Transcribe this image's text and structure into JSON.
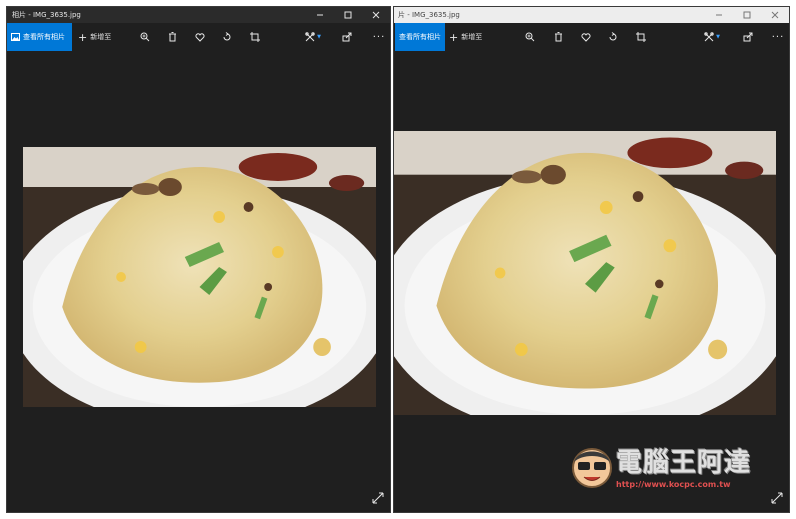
{
  "left_window": {
    "title": "相片 - IMG_3635.jpg",
    "all_photos_label": "查看所有相片",
    "add_label": "新增至",
    "more_label": "···"
  },
  "right_window": {
    "title": "片 - IMG_3635.jpg",
    "all_photos_label": "查看所有相片",
    "add_label": "新增至",
    "more_label": "···"
  },
  "watermark": {
    "name": "電腦王阿達",
    "url": "http://www.kocpc.com.tw"
  },
  "icons": {
    "minimize": "minimize-icon",
    "maximize": "maximize-icon",
    "close": "close-icon",
    "photos": "photos-icon",
    "add": "plus-icon",
    "zoom": "zoom-in-icon",
    "delete": "trash-icon",
    "favorite": "heart-icon",
    "rotate": "rotate-icon",
    "crop": "crop-icon",
    "edit": "edit-icon",
    "share": "share-icon",
    "expand": "expand-icon"
  },
  "colors": {
    "accent": "#0078d7",
    "dark_bg": "#1f1f1f"
  }
}
